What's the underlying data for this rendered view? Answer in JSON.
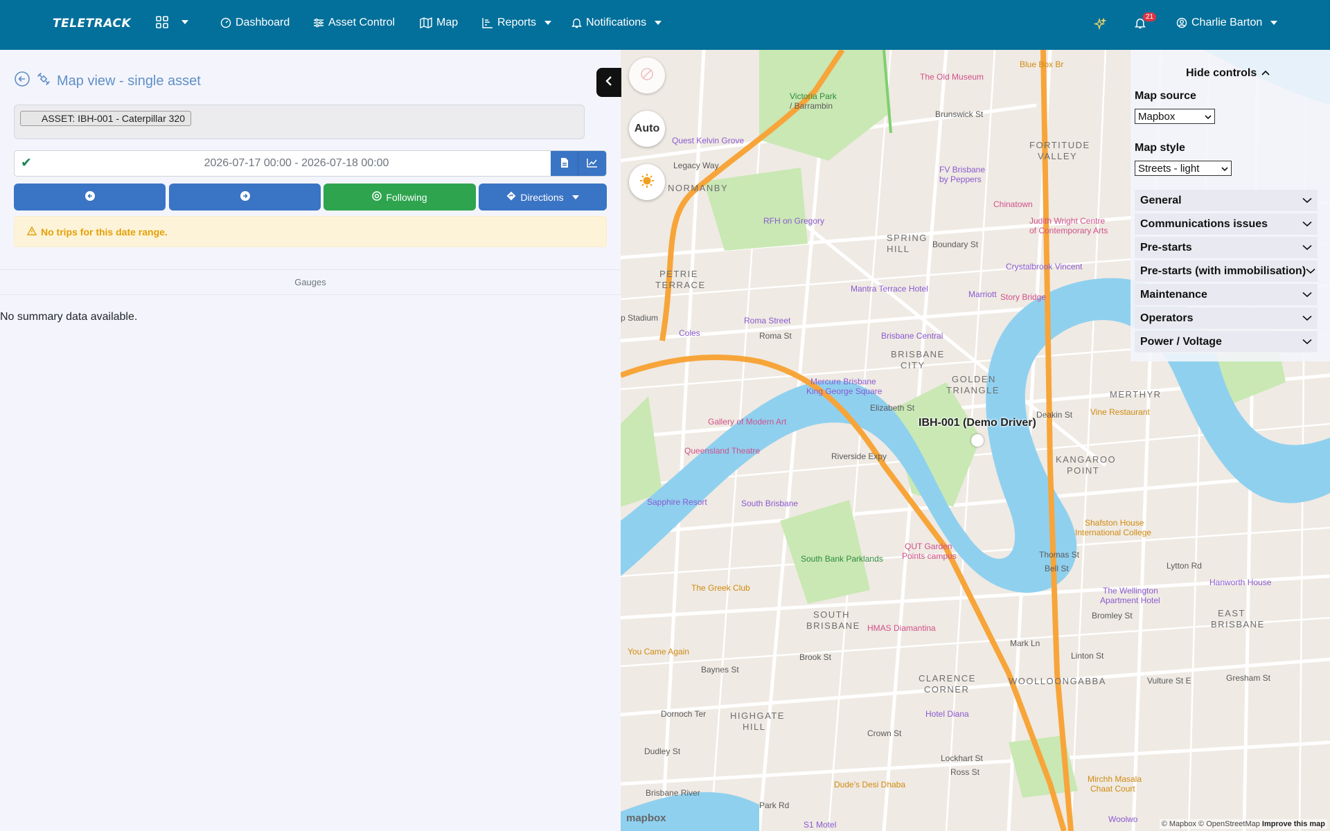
{
  "navbar": {
    "brand": "TELETRACK",
    "items": [
      {
        "label": "Dashboard"
      },
      {
        "label": "Asset Control"
      },
      {
        "label": "Map"
      },
      {
        "label": "Reports"
      },
      {
        "label": "Notifications"
      }
    ],
    "notification_count": "21",
    "user_name": "Charlie Barton"
  },
  "page": {
    "title": "Map view - single asset",
    "asset_chip": "ASSET: IBH-001 - Caterpillar 320",
    "date_range": "2026-07-17 00:00 - 2026-07-18 00:00",
    "following_label": "Following",
    "directions_label": "Directions",
    "alert": "No trips for this date range.",
    "gauges": "Gauges",
    "no_summary": "No summary data available."
  },
  "map": {
    "auto_label": "Auto",
    "asset_label": "IBH-001 (Demo Driver)",
    "mapbox_logo": "mapbox",
    "attribution_1": "© Mapbox © OpenStreetMap",
    "attribution_2": "Improve this map",
    "labels": {
      "old_museum": "The Old Museum",
      "victoria_park": "Victoria Park",
      "barrambin": "/ Barrambin",
      "quest": "Quest Kelvin Grove",
      "legacy_way": "Legacy Way",
      "normanby": "NORMANBY",
      "fv_brisbane": "FV Brisbane",
      "by_peppers": "by Peppers",
      "fortitude": "FORTITUDE",
      "valley": "VALLEY",
      "chinatown": "Chinatown",
      "judith_wright": "Judith Wright Centre",
      "contemporary": "of Contemporary Arts",
      "rfh": "RFH on Gregory",
      "spring_hill_1": "SPRING",
      "spring_hill_2": "HILL",
      "boundary": "Boundary St",
      "petrie_1": "PETRIE",
      "petrie_2": "TERRACE",
      "mantra": "Mantra Terrace Hotel",
      "crystalbrook": "Crystalbrook Vincent",
      "marriott": "Marriott",
      "story_bridge": "Story Bridge",
      "roma_street": "Roma Street",
      "coles": "Coles",
      "stadium": "p Stadium",
      "brisbane_central": "Brisbane Central",
      "brisbane_city_1": "BRISBANE",
      "brisbane_city_2": "CITY",
      "golden_1": "GOLDEN",
      "golden_2": "TRIANGLE",
      "mercure_1": "Mercure Brisbane",
      "mercure_2": "King George Square",
      "merthyr": "MERTHYR",
      "vine": "Vine Restaurant",
      "gallery": "Gallery of Modern Art",
      "queensland_theatre": "Queensland Theatre",
      "kangaroo_1": "KANGAROO",
      "kangaroo_2": "POINT",
      "sapphire": "Sapphire Resort",
      "south_brisbane": "South Brisbane",
      "shafston_1": "Shafston House",
      "shafston_2": "International College",
      "qut_1": "QUT Garden",
      "qut_2": "Points campus",
      "southbank": "South Bank Parklands",
      "thomas_st": "Thomas St",
      "bell_st": "Bell St",
      "lytton": "Lytton Rd",
      "hanworth": "Hanworth House",
      "greek_club": "The Greek Club",
      "wellington_1": "The Wellington",
      "wellington_2": "Apartment Hotel",
      "south_1": "SOUTH",
      "south_2": "BRISBANE",
      "hmas": "HMAS Diamantina",
      "east_1": "EAST",
      "east_2": "BRISBANE",
      "you_came": "You Came Again",
      "woolloongabba": "WOOLLOONGABBA",
      "clarence_1": "CLARENCE",
      "clarence_2": "CORNER",
      "hotel_diana": "Hotel Diana",
      "highgate_1": "HIGHGATE",
      "highgate_2": "HILL",
      "dornoch": "Dornoch Ter",
      "dudley": "Dudley St",
      "dudes": "Dude's Desi Dhaba",
      "mirchi_1": "Mirchh Masala",
      "mirchi_2": "Chaat Court",
      "brisbane_river": "Brisbane River",
      "s1_motel": "S1 Motel",
      "woolworths": "Woolwo",
      "park_rd": "Park Rd",
      "blue_box": "Blue Box Br",
      "brunswick": "Brunswick St",
      "roma_st": "Roma St",
      "elizabeth": "Elizabeth St",
      "riverside": "Riverside Expy",
      "vulture": "Vulture St E",
      "deakin": "Deakin St",
      "crown": "Crown St",
      "lockhart": "Lockhart St",
      "ross": "Ross St",
      "brook": "Brook St",
      "baynes": "Baynes St",
      "mark_ln": "Mark Ln",
      "linton": "Linton St",
      "gresham": "Gresham St",
      "bromley": "Bromley St"
    }
  },
  "controls": {
    "hide_label": "Hide controls",
    "map_source_label": "Map source",
    "map_source_value": "Mapbox",
    "map_style_label": "Map style",
    "map_style_value": "Streets - light",
    "sections": [
      {
        "label": "General"
      },
      {
        "label": "Communications issues"
      },
      {
        "label": "Pre-starts"
      },
      {
        "label": "Pre-starts (with immobilisation)"
      },
      {
        "label": "Maintenance"
      },
      {
        "label": "Operators"
      },
      {
        "label": "Power / Voltage"
      }
    ]
  },
  "colors": {
    "navbar": "#03709b",
    "primary": "#3a74c4",
    "success": "#2ea44f",
    "warning_text": "#e3a008",
    "river": "#8fd0ef",
    "park": "#c9e8b4",
    "motorway": "#f7a53a"
  }
}
